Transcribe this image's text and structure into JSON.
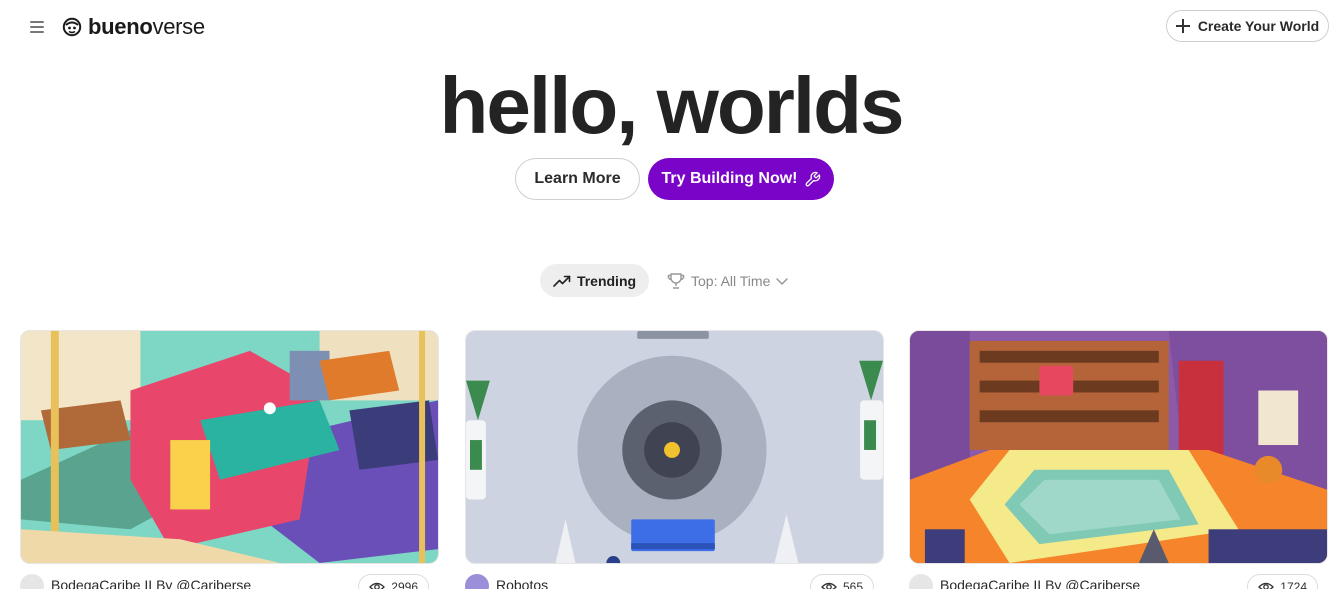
{
  "header": {
    "brand_bold": "bueno",
    "brand_light": "verse",
    "create_label": "Create Your World"
  },
  "hero": {
    "title": "hello, worlds",
    "learn_more_label": "Learn More",
    "try_label": "Try Building Now!"
  },
  "filters": {
    "trending_label": "Trending",
    "top_label": "Top: All Time"
  },
  "cards": [
    {
      "title": "BodegaCaribe II By @Cariberse",
      "views": "2996"
    },
    {
      "title": "Robotos",
      "views": "565"
    },
    {
      "title": "BodegaCaribe II By @Cariberse",
      "views": "1724"
    }
  ],
  "colors": {
    "accent": "#7a05c9",
    "text": "#1f1f1f",
    "muted": "#888888"
  },
  "icons": [
    "menu-icon",
    "bueno-logo-icon",
    "plus-icon",
    "wrench-icon",
    "trending-icon",
    "trophy-icon",
    "chevron-down-icon",
    "eye-icon"
  ]
}
